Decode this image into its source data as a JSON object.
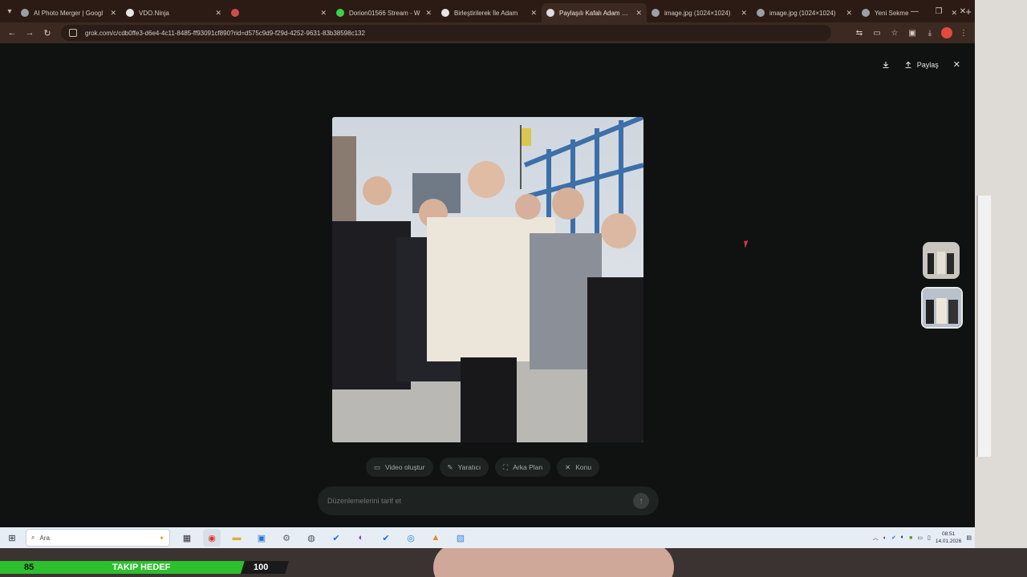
{
  "browser": {
    "tabs": [
      {
        "title": "AI Photo Merger | Googl",
        "fav": "#9aa0a6"
      },
      {
        "title": "VDO.Ninja",
        "fav": "#e6e6e6"
      },
      {
        "title": "",
        "fav": "#d14a4a"
      },
      {
        "title": "Dorion01566 Stream - W",
        "fav": "#3bd14a"
      },
      {
        "title": "Birleştirilerek İle Adam",
        "fav": "#e6e6e6"
      },
      {
        "title": "Paylaşılı Kafalı Adam Kazı",
        "fav": "#dddddd"
      },
      {
        "title": "image.jpg (1024×1024)",
        "fav": "#9aa0a6"
      },
      {
        "title": "image.jpg (1024×1024)",
        "fav": "#9aa0a6"
      },
      {
        "title": "Yeni Sekme",
        "fav": "#9aa0a6"
      }
    ],
    "active_tab": 5,
    "url": "grok.com/c/cdb0ffe3-d6e4-4c11-8485-ff93091cf890?rid=d575c9d9-f29d-4252-9631-83b38598c132"
  },
  "viewer": {
    "download_icon": "download-icon",
    "share_label": "Paylaş",
    "chips": [
      {
        "icon": "video-icon",
        "label": "Video oluştur"
      },
      {
        "icon": "sparkle-icon",
        "label": "Yaratıcı"
      },
      {
        "icon": "image-icon",
        "label": "Arka Plan"
      },
      {
        "icon": "close-icon",
        "label": "Konu"
      }
    ],
    "prompt_placeholder": "Düzenlemelerini tarif et"
  },
  "taskbar": {
    "search_placeholder": "Ara",
    "time": "08:51",
    "date": "14.01.2026"
  },
  "overlay": {
    "current": "85",
    "label": "TAKIP HEDEF",
    "target": "100"
  }
}
